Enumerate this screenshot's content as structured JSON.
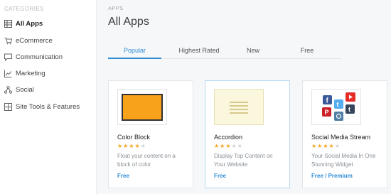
{
  "sidebar": {
    "heading": "CATEGORIES",
    "items": [
      {
        "label": "All Apps",
        "icon": "grid-icon"
      },
      {
        "label": "eCommerce",
        "icon": "cart-icon"
      },
      {
        "label": "Communication",
        "icon": "chat-icon"
      },
      {
        "label": "Marketing",
        "icon": "chart-icon"
      },
      {
        "label": "Social",
        "icon": "share-icon"
      },
      {
        "label": "Site Tools & Features",
        "icon": "tools-grid-icon"
      }
    ]
  },
  "main": {
    "breadcrumb": "APPS",
    "title": "All Apps",
    "tabs": [
      {
        "label": "Popular",
        "active": true
      },
      {
        "label": "Highest Rated",
        "active": false
      },
      {
        "label": "New",
        "active": false
      },
      {
        "label": "Free",
        "active": false
      }
    ]
  },
  "cards": [
    {
      "title": "Color Block",
      "rating": 4,
      "rating_max": 5,
      "description": "Float your content on a block of color",
      "price": "Free",
      "thumb_color": "#f8a21c"
    },
    {
      "title": "Accordion",
      "rating": 3,
      "rating_max": 5,
      "description": "Display Top Content on Your Website",
      "price": "Free",
      "thumb_color": "#fbf7dc"
    },
    {
      "title": "Social Media Stream",
      "rating": 4,
      "rating_max": 5,
      "description": "Your Social Media In One Stunning Widget",
      "price": "Free / Premium"
    }
  ],
  "colors": {
    "accent": "#2f8dd6",
    "star": "#f3a51e",
    "facebook": "#3b5998",
    "twitter": "#55acee",
    "youtube": "#e52d27",
    "pinterest": "#cb2027",
    "instagram": "#517fa4",
    "tumblr": "#35465c"
  }
}
